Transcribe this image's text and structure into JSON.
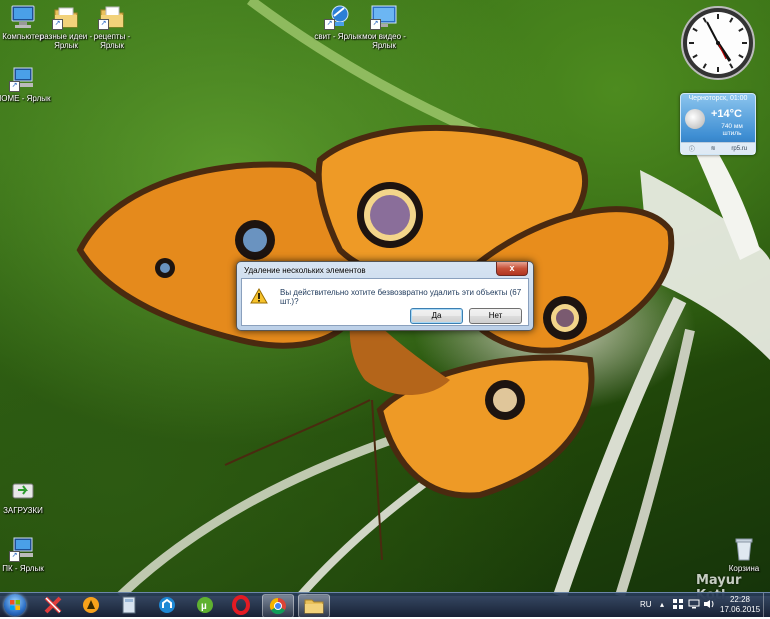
{
  "desktop": {
    "icons": [
      {
        "label": "Компьютер",
        "icon": "computer-icon"
      },
      {
        "label": "разные идеи - Ярлык",
        "icon": "folder-icon"
      },
      {
        "label": "рецепты - Ярлык",
        "icon": "document-icon"
      },
      {
        "label": "свит - Ярлык",
        "icon": "globe-icon"
      },
      {
        "label": "мои видео - Ярлык",
        "icon": "monitor-icon"
      },
      {
        "label": "HOME - Ярлык",
        "icon": "network-computer-icon"
      },
      {
        "label": "ЗАГРУЗКИ",
        "icon": "downloads-icon"
      },
      {
        "label": "ПК - Ярлык",
        "icon": "pc-icon"
      },
      {
        "label": "Корзина",
        "icon": "recycle-bin-icon"
      }
    ],
    "watermark": "Mayur Kotl"
  },
  "weather": {
    "city_time": "Черноторск, 01:00",
    "temp": "+14°C",
    "pressure": "740 мм",
    "wind": "штиль",
    "source": "rp5.ru"
  },
  "dialog": {
    "title": "Удаление нескольких элементов",
    "message": "Вы действительно хотите безвозвратно удалить эти объекты (67 шт.)?",
    "yes_label": "Да",
    "no_label": "Нет",
    "close_label": "x"
  },
  "taskbar": {
    "apps": [
      "solitaire-icon",
      "aimp-icon",
      "calculator-icon",
      "tracker-icon",
      "utorrent-icon",
      "opera-icon",
      "chrome-icon",
      "explorer-icon"
    ],
    "language": "RU",
    "time": "22:28",
    "date": "17.06.2015"
  }
}
